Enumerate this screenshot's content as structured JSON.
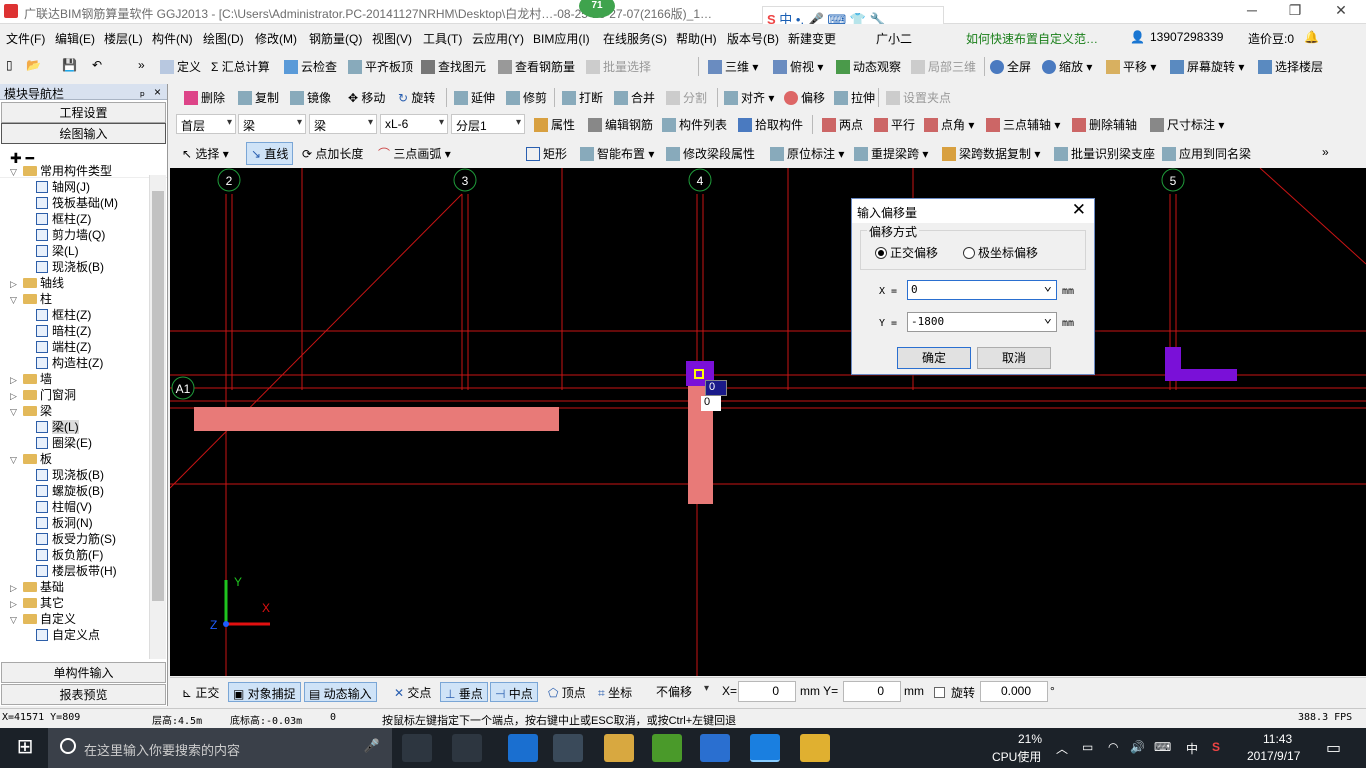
{
  "titlebar": {
    "title": "广联达BIM钢筋算量软件 GGJ2013 - [C:\\Users\\Administrator.PC-20141127NRHM\\Desktop\\白龙村…-08-25-13-27-07(2166版)_1…",
    "badge": "71",
    "min": "─",
    "max": "❐",
    "close": "✕"
  },
  "menu": [
    "文件(F)",
    "编辑(E)",
    "楼层(L)",
    "构件(N)",
    "绘图(D)",
    "修改(M)",
    "钢筋量(Q)",
    "视图(V)",
    "工具(T)",
    "云应用(Y)",
    "BIM应用(I)",
    "在线服务(S)",
    "帮助(H)",
    "版本号(B)",
    "新建变更",
    "广小二",
    "如何快速布置自定义范…",
    "13907298339",
    "造价豆:0"
  ],
  "toolbar1": [
    "定义",
    "汇总计算",
    "云检查",
    "平齐板顶",
    "查找图元",
    "查看钢筋量",
    "批量选择",
    "三维",
    "俯视",
    "动态观察",
    "局部三维",
    "全屏",
    "缩放",
    "平移",
    "屏幕旋转",
    "选择楼层"
  ],
  "toolbar2": [
    "删除",
    "复制",
    "镜像",
    "移动",
    "旋转",
    "延伸",
    "修剪",
    "打断",
    "合并",
    "分割",
    "对齐",
    "偏移",
    "拉伸",
    "设置夹点"
  ],
  "toolbar3": {
    "floor": "首层",
    "type": "梁",
    "type2": "梁",
    "name": "xL-6",
    "layer": "分层1",
    "btns": [
      "属性",
      "编辑钢筋",
      "构件列表",
      "拾取构件",
      "两点",
      "平行",
      "点角",
      "三点辅轴",
      "删除辅轴",
      "尺寸标注"
    ]
  },
  "toolbar4": [
    "选择",
    "直线",
    "点加长度",
    "三点画弧",
    "矩形",
    "智能布置",
    "修改梁段属性",
    "原位标注",
    "重提梁跨",
    "梁跨数据复制",
    "批量识别梁支座",
    "应用到同名梁"
  ],
  "leftpanel": {
    "title": "模块导航栏",
    "pin": "ₚ",
    "close": "×",
    "btn1": "工程设置",
    "btn2": "绘图输入",
    "btn3": "单构件输入",
    "btn4": "报表预览",
    "tools": "✚ ━",
    "tree": [
      {
        "label": "常用构件类型",
        "lvl": 0,
        "exp": "▽",
        "folder": true
      },
      {
        "label": "轴网(J)",
        "lvl": 1
      },
      {
        "label": "筏板基础(M)",
        "lvl": 1
      },
      {
        "label": "框柱(Z)",
        "lvl": 1
      },
      {
        "label": "剪力墙(Q)",
        "lvl": 1
      },
      {
        "label": "梁(L)",
        "lvl": 1
      },
      {
        "label": "现浇板(B)",
        "lvl": 1
      },
      {
        "label": "轴线",
        "lvl": 0,
        "exp": "▷",
        "folder": true
      },
      {
        "label": "柱",
        "lvl": 0,
        "exp": "▽",
        "folder": true
      },
      {
        "label": "框柱(Z)",
        "lvl": 1
      },
      {
        "label": "暗柱(Z)",
        "lvl": 1
      },
      {
        "label": "端柱(Z)",
        "lvl": 1
      },
      {
        "label": "构造柱(Z)",
        "lvl": 1
      },
      {
        "label": "墙",
        "lvl": 0,
        "exp": "▷",
        "folder": true
      },
      {
        "label": "门窗洞",
        "lvl": 0,
        "exp": "▷",
        "folder": true
      },
      {
        "label": "梁",
        "lvl": 0,
        "exp": "▽",
        "folder": true
      },
      {
        "label": "梁(L)",
        "lvl": 1,
        "sel": true
      },
      {
        "label": "圈梁(E)",
        "lvl": 1
      },
      {
        "label": "板",
        "lvl": 0,
        "exp": "▽",
        "folder": true
      },
      {
        "label": "现浇板(B)",
        "lvl": 1
      },
      {
        "label": "螺旋板(B)",
        "lvl": 1
      },
      {
        "label": "柱帽(V)",
        "lvl": 1
      },
      {
        "label": "板洞(N)",
        "lvl": 1
      },
      {
        "label": "板受力筋(S)",
        "lvl": 1
      },
      {
        "label": "板负筋(F)",
        "lvl": 1
      },
      {
        "label": "楼层板带(H)",
        "lvl": 1
      },
      {
        "label": "基础",
        "lvl": 0,
        "exp": "▷",
        "folder": true
      },
      {
        "label": "其它",
        "lvl": 0,
        "exp": "▷",
        "folder": true
      },
      {
        "label": "自定义",
        "lvl": 0,
        "exp": "▽",
        "folder": true
      },
      {
        "label": "自定义点",
        "lvl": 1
      }
    ]
  },
  "canvas": {
    "axes": [
      "2",
      "3",
      "4",
      "5"
    ],
    "row_axis": "A1",
    "y_label": "Y",
    "x_label": "X",
    "z_label": "Z",
    "tip1": "0",
    "tip2": "0"
  },
  "dialog": {
    "title": "输入偏移量",
    "group": "偏移方式",
    "radio1": "正交偏移",
    "radio2": "极坐标偏移",
    "x_label": "X =",
    "x_value": "0",
    "y_label": "Y =",
    "y_value": "-1800",
    "unit": "mm",
    "ok": "确定",
    "cancel": "取消",
    "close": "✕"
  },
  "snapbar": {
    "items": [
      "正交",
      "对象捕捉",
      "动态输入",
      "交点",
      "垂点",
      "中点",
      "顶点",
      "坐标"
    ],
    "offset": "不偏移",
    "x_label": "X=",
    "x_val": "0",
    "y_label": "mm Y=",
    "y_val": "0",
    "mm": "mm",
    "rotate": "旋转",
    "rot_val": "0.000",
    "deg": "°"
  },
  "status": {
    "coord": "X=41571 Y=809",
    "floor_h": "层高:4.5m",
    "bottom_h": "底标高:-0.03m",
    "zero": "0",
    "hint": "按鼠标左键指定下一个端点，按右键中止或ESC取消，或按Ctrl+左键回退",
    "fps": "388.3 FPS"
  },
  "taskbar": {
    "search": "在这里输入你要搜索的内容",
    "cpu": "21%",
    "cpu_label": "CPU使用",
    "ime": "中",
    "time": "11:43",
    "date": "2017/9/17"
  },
  "colors": {
    "axis_red": "#d11",
    "beam_pink": "#e87a78",
    "purple": "#7a10d8",
    "canvas_bg": "#000000"
  }
}
